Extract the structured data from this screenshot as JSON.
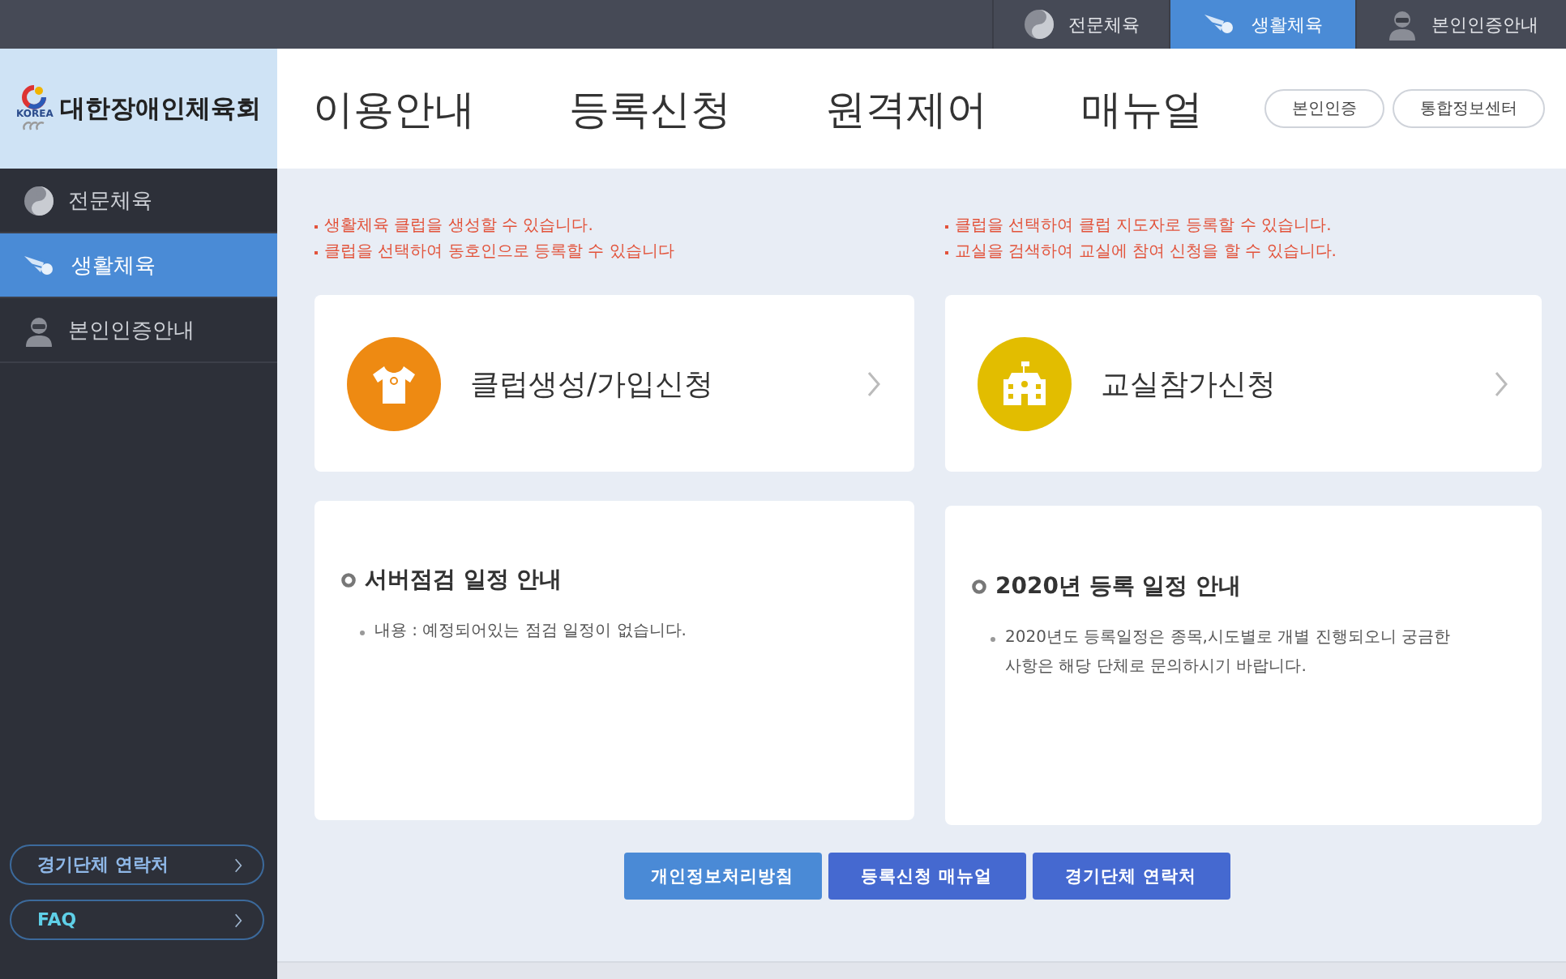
{
  "top_tabs": [
    {
      "label": "전문체육",
      "selected": false
    },
    {
      "label": "생활체육",
      "selected": true
    },
    {
      "label": "본인인증안내",
      "selected": false
    }
  ],
  "sidebar": {
    "logo_mark": "KOREA",
    "logo_text": "대한장애인체육회",
    "items": [
      {
        "label": "전문체육",
        "selected": false
      },
      {
        "label": "생활체육",
        "selected": true
      },
      {
        "label": "본인인증안내",
        "selected": false
      }
    ],
    "links": [
      {
        "label": "경기단체 연락처",
        "color": "#8fb8e8"
      },
      {
        "label": "FAQ",
        "color": "#5fd0e8"
      }
    ]
  },
  "nav": [
    "이용안내",
    "등록신청",
    "원격제어",
    "매뉴얼"
  ],
  "header_buttons": [
    "본인인증",
    "통합정보센터"
  ],
  "services": [
    {
      "notes": [
        "생활체육 클럽을 생성할 수 있습니다.",
        "클럽을 선택하여 동호인으로 등록할 수 있습니다"
      ],
      "title": "클럽생성/가입신청",
      "kind": "shirt",
      "color": "#ee8a12"
    },
    {
      "notes": [
        "클럽을 선택하여 클럽 지도자로 등록할 수 있습니다.",
        "교실을 검색하여 교실에 참여 신청을 할 수 있습니다."
      ],
      "title": "교실참가신청",
      "kind": "school",
      "color": "#e2bd00"
    }
  ],
  "notices": [
    {
      "title": "서버점검 일정 안내",
      "items": [
        "내용 : 예정되어있는 점검 일정이 없습니다."
      ]
    },
    {
      "title": "2020년 등록 일정 안내",
      "items": [
        "2020년도 등록일정은 종목,시도별로 개별 진행되오니 궁금한 사항은 해당 단체로 문의하시기 바랍니다."
      ]
    }
  ],
  "footer_buttons": [
    {
      "label": "개인정보처리방침",
      "color": "#4a8ad6"
    },
    {
      "label": "등록신청 매뉴얼",
      "color": "#4569d0"
    },
    {
      "label": "경기단체 연락처",
      "color": "#4569d0"
    }
  ]
}
